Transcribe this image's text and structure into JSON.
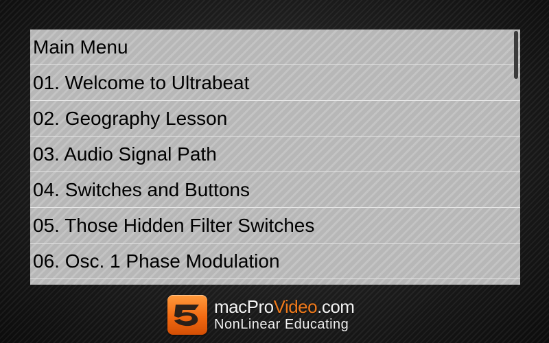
{
  "menu": {
    "header": "Main Menu",
    "items": [
      {
        "label": "01. Welcome to Ultrabeat"
      },
      {
        "label": "02. Geography Lesson"
      },
      {
        "label": "03. Audio Signal Path"
      },
      {
        "label": "04. Switches and Buttons"
      },
      {
        "label": "05. Those Hidden Filter Switches"
      },
      {
        "label": "06. Osc. 1 Phase Modulation"
      },
      {
        "label": ""
      }
    ]
  },
  "brand": {
    "name_prefix": "macPro",
    "name_accent": "Video",
    "name_suffix": ".com",
    "tagline": "NonLinear Educating",
    "accent_color": "#f07a1c",
    "icon": "macprovideo-logo-icon"
  }
}
